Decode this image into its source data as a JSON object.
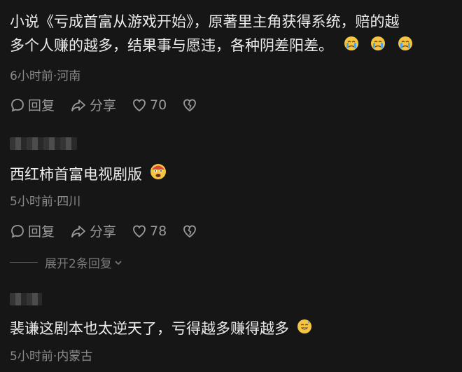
{
  "comments": [
    {
      "text_line1": "小说《亏成首富从游戏开始》，原著里主角获得系统，赔的越",
      "text_line2": "多个人赚的越多，结果事与愿违，各种阴差阳差。",
      "meta": "6小时前·河南",
      "reply_label": "回复",
      "share_label": "分享",
      "likes": "70",
      "emojis": [
        "crying-face",
        "crying-face",
        "crying-face"
      ]
    },
    {
      "text": "西红柿首富电视剧版",
      "meta": "5小时前·四川",
      "reply_label": "回复",
      "share_label": "分享",
      "likes": "78",
      "emojis": [
        "fearful-face"
      ]
    },
    {
      "text": "裴谦这剧本也太逆天了，亏得越多赚得越多",
      "meta": "5小时前·内蒙古",
      "emojis": [
        "grinning-sweat-face"
      ]
    }
  ],
  "expand_replies": "展开2条回复"
}
